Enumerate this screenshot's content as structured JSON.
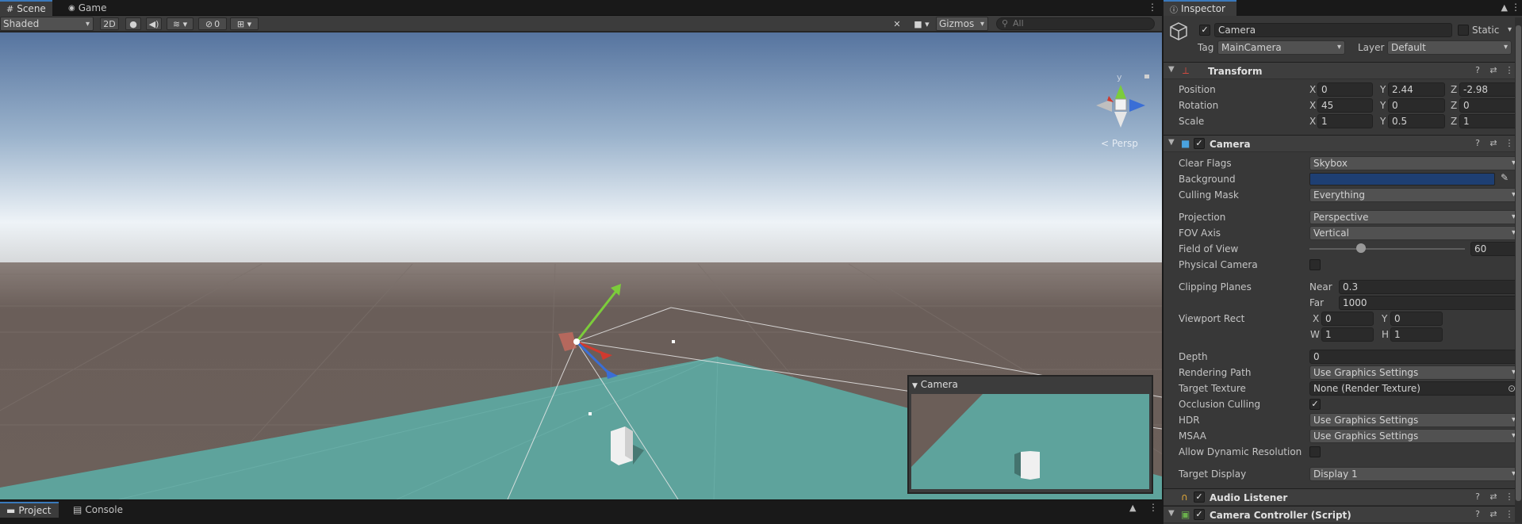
{
  "scene_tabs": [
    {
      "label": "Scene",
      "icon": "grid-icon"
    },
    {
      "label": "Game",
      "icon": "gamepad-icon"
    }
  ],
  "scene_toolbar": {
    "draw_mode": "Shaded",
    "toggle_2d": "2D",
    "hidden_count": "0",
    "gizmos_label": "Gizmos",
    "search_placeholder": "All"
  },
  "viewport": {
    "axis_y": "y",
    "persp_label": "< Persp",
    "camera_preview_title": "Camera",
    "sky_top": "#5c7aa6",
    "sky_horizon": "#eaf0f5",
    "ground_color": "#6b5e58",
    "plane_color": "#5fa49d"
  },
  "bottom_tabs": [
    {
      "label": "Project",
      "icon": "folder-icon"
    },
    {
      "label": "Console",
      "icon": "console-icon"
    }
  ],
  "inspector": {
    "tab_label": "Inspector",
    "object_name": "Camera",
    "static_label": "Static",
    "tag_label": "Tag",
    "tag_value": "MainCamera",
    "layer_label": "Layer",
    "layer_value": "Default",
    "transform": {
      "title": "Transform",
      "position_label": "Position",
      "rotation_label": "Rotation",
      "scale_label": "Scale",
      "position": {
        "x": "0",
        "y": "2.44",
        "z": "-2.98"
      },
      "rotation": {
        "x": "45",
        "y": "0",
        "z": "0"
      },
      "scale": {
        "x": "1",
        "y": "0.5",
        "z": "1"
      }
    },
    "camera": {
      "title": "Camera",
      "clear_flags_label": "Clear Flags",
      "clear_flags_value": "Skybox",
      "background_label": "Background",
      "background_color": "#1e3f73",
      "culling_mask_label": "Culling Mask",
      "culling_mask_value": "Everything",
      "projection_label": "Projection",
      "projection_value": "Perspective",
      "fov_axis_label": "FOV Axis",
      "fov_axis_value": "Vertical",
      "fov_label": "Field of View",
      "fov_value": "60",
      "fov_fraction": 0.33,
      "physical_camera_label": "Physical Camera",
      "clipping_label": "Clipping Planes",
      "near_label": "Near",
      "near_value": "0.3",
      "far_label": "Far",
      "far_value": "1000",
      "viewport_rect_label": "Viewport Rect",
      "vr_x": "0",
      "vr_y": "0",
      "vr_w": "1",
      "vr_h": "1",
      "depth_label": "Depth",
      "depth_value": "0",
      "rendering_path_label": "Rendering Path",
      "rendering_path_value": "Use Graphics Settings",
      "target_texture_label": "Target Texture",
      "target_texture_value": "None (Render Texture)",
      "occlusion_label": "Occlusion Culling",
      "hdr_label": "HDR",
      "hdr_value": "Use Graphics Settings",
      "msaa_label": "MSAA",
      "msaa_value": "Use Graphics Settings",
      "dynres_label": "Allow Dynamic Resolution",
      "target_display_label": "Target Display",
      "target_display_value": "Display 1"
    },
    "audio_listener_title": "Audio Listener",
    "camera_controller_title": "Camera Controller (Script)"
  }
}
